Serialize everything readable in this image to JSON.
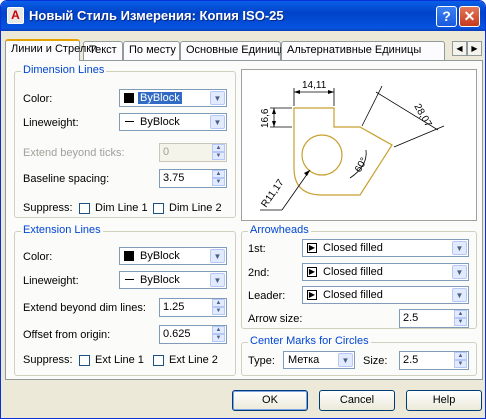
{
  "window": {
    "title": "Новый Стиль Измерения: Копия ISO-25",
    "help_glyph": "?",
    "close_glyph": "✕"
  },
  "tabs": [
    {
      "label": "Линии и Стрелки"
    },
    {
      "label": "Текст"
    },
    {
      "label": "По месту"
    },
    {
      "label": "Основные Единицы"
    },
    {
      "label": "Альтернативные Единицы"
    }
  ],
  "dimension_lines": {
    "title": "Dimension Lines",
    "color_label": "Color:",
    "color_value": "ByBlock",
    "lineweight_label": "Lineweight:",
    "lineweight_value": "ByBlock",
    "extend_label": "Extend beyond ticks:",
    "extend_value": "0",
    "baseline_label": "Baseline spacing:",
    "baseline_value": "3.75",
    "suppress_label": "Suppress:",
    "dim_line1": "Dim Line 1",
    "dim_line2": "Dim Line 2"
  },
  "extension_lines": {
    "title": "Extension Lines",
    "color_label": "Color:",
    "color_value": "ByBlock",
    "lineweight_label": "Lineweight:",
    "lineweight_value": "ByBlock",
    "extend_label": "Extend beyond dim lines:",
    "extend_value": "1.25",
    "offset_label": "Offset from origin:",
    "offset_value": "0.625",
    "suppress_label": "Suppress:",
    "ext_line1": "Ext Line 1",
    "ext_line2": "Ext Line 2"
  },
  "preview": {
    "dim_top": "14,11",
    "dim_left": "16,6",
    "dim_right": "28,07",
    "dim_angle": "60°",
    "dim_radius": "R11,17"
  },
  "arrowheads": {
    "title": "Arrowheads",
    "first_label": "1st:",
    "first_value": "Closed filled",
    "second_label": "2nd:",
    "second_value": "Closed filled",
    "leader_label": "Leader:",
    "leader_value": "Closed filled",
    "size_label": "Arrow size:",
    "size_value": "2.5"
  },
  "center_marks": {
    "title": "Center Marks for Circles",
    "type_label": "Type:",
    "type_value": "Метка",
    "size_label": "Size:",
    "size_value": "2.5"
  },
  "buttons": {
    "ok": "OK",
    "cancel": "Cancel",
    "help": "Help"
  },
  "colors": {
    "titlebar": "#0a5fe8",
    "accent": "#0046d5",
    "selection": "#316ac5",
    "drawing": "#c8a030"
  }
}
